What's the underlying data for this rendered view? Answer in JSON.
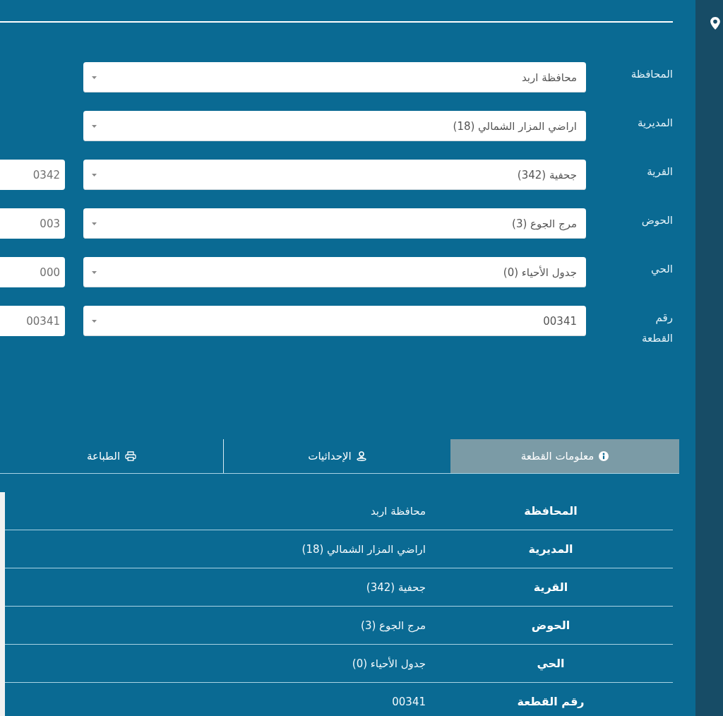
{
  "form": {
    "fields": [
      {
        "label": "المحافظة",
        "value": "محافظة اربد"
      },
      {
        "label": "المديرية",
        "value": "اراضي المزار الشمالي (18)"
      },
      {
        "label": "القرية",
        "value": "جحفية (342)",
        "code": "0342"
      },
      {
        "label": "الحوض",
        "value": "مرج الجوع (3)",
        "code": "003"
      },
      {
        "label": "الحي",
        "value": "جدول الأحياء (0)",
        "code": "000"
      },
      {
        "label": "رقم القطعة",
        "value": "00341",
        "code": "00341"
      }
    ]
  },
  "tabs": [
    {
      "label": "معلومات القطعة",
      "kind": "info",
      "selected": true
    },
    {
      "label": "الإحداثيات",
      "kind": "coordinates",
      "selected": false
    },
    {
      "label": "الطباعة",
      "kind": "print",
      "selected": false
    }
  ],
  "plot_info": {
    "rows": [
      {
        "key": "المحافظة",
        "value": "محافظة اربد"
      },
      {
        "key": "المديرية",
        "value": "اراضي المزار الشمالي (18)"
      },
      {
        "key": "القرية",
        "value": "جحفية (342)"
      },
      {
        "key": "الحوض",
        "value": "مرج الجوع (3)"
      },
      {
        "key": "الحي",
        "value": "جدول الأحياء (0)"
      },
      {
        "key": "رقم القطعة",
        "value": "00341"
      }
    ]
  }
}
